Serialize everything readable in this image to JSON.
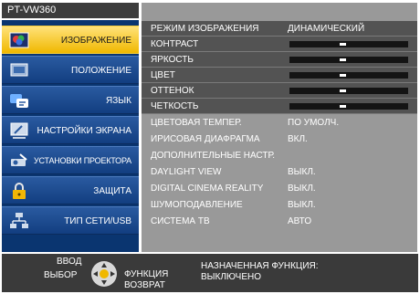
{
  "title": "PT-VW360",
  "sidebar": {
    "items": [
      {
        "label": "ИЗОБРАЖЕНИЕ",
        "icon": "picture-icon",
        "active": true
      },
      {
        "label": "ПОЛОЖЕНИЕ",
        "icon": "position-icon",
        "active": false
      },
      {
        "label": "ЯЗЫК",
        "icon": "language-icon",
        "active": false
      },
      {
        "label": "НАСТРОЙКИ ЭКРАНА",
        "icon": "screen-settings-icon",
        "active": false
      },
      {
        "label": "УСТАНОВКИ ПРОЕКТОРА",
        "icon": "projector-settings-icon",
        "active": false
      },
      {
        "label": "ЗАЩИТА",
        "icon": "lock-icon",
        "active": false
      },
      {
        "label": "ТИП СЕТИ/USB",
        "icon": "network-icon",
        "active": false
      }
    ]
  },
  "menu": {
    "rows": [
      {
        "name": "РЕЖИМ ИЗОБРАЖЕНИЯ",
        "value": "ДИНАМИЧЕСКИЙ"
      },
      {
        "name": "КОНТРАСТ",
        "slider": 0.45
      },
      {
        "name": "ЯРКОСТЬ",
        "slider": 0.45
      },
      {
        "name": "ЦВЕТ",
        "slider": 0.45
      },
      {
        "name": "ОТТЕНОК",
        "slider": 0.45
      },
      {
        "name": "ЧЕТКОСТЬ",
        "slider": 0.45
      },
      {
        "name": "ЦВЕТОВАЯ ТЕМПЕР.",
        "value": "ПО УМОЛЧ."
      },
      {
        "name": "ИРИСОВАЯ ДИАФРАГМА",
        "value": "ВКЛ."
      },
      {
        "name": "ДОПОЛНИТЕЛЬНЫЕ НАСТР.",
        "value": ""
      },
      {
        "name": "DAYLIGHT VIEW",
        "value": "ВЫКЛ."
      },
      {
        "name": "DIGITAL CINEMA REALITY",
        "value": "ВЫКЛ."
      },
      {
        "name": "ШУМОПОДАВЛЕНИЕ",
        "value": "ВЫКЛ."
      },
      {
        "name": "СИСТЕМА ТВ",
        "value": "АВТО"
      }
    ]
  },
  "bottom": {
    "enter_label": "ВВОД",
    "select_label": "ВЫБОР",
    "function_label": "ФУНКЦИЯ",
    "return_label": "ВОЗВРАТ",
    "assigned_label": "НАЗНАЧЕННАЯ ФУНКЦИЯ:",
    "assigned_value": "ВЫКЛЮЧЕНО"
  },
  "colors": {
    "active": "#f0b800",
    "sidebar": "#123e80",
    "panel": "#999999",
    "top_rows": "#535353",
    "bottom_bar": "#3a3a3a"
  }
}
